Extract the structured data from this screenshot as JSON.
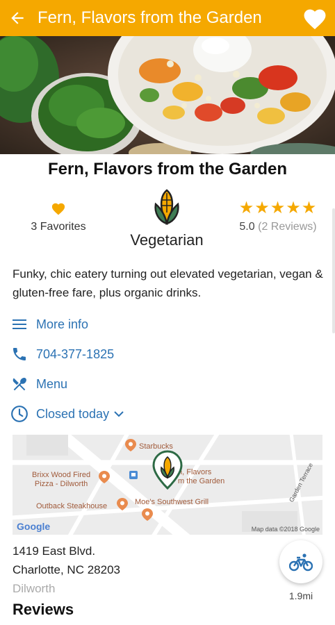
{
  "header": {
    "title": "Fern, Flavors from the Garden",
    "bg_color": "#f5a800",
    "back_icon": "arrow-left-icon",
    "favorite_icon": "heart-icon"
  },
  "restaurant": {
    "name": "Fern, Flavors from the Garden",
    "favorites": "3 Favorites",
    "category": "Vegetarian",
    "category_icon": "corn-icon",
    "stars": "★★★★★",
    "rating": "5.0",
    "reviews_count": "(2 Reviews)",
    "description": "Funky, chic eatery turning out elevated vegetarian, vegan & gluten-free fare, plus organic drinks."
  },
  "actions": {
    "more_info": "More info",
    "phone": "704-377-1825",
    "menu": "Menu",
    "hours": "Closed today"
  },
  "map": {
    "labels": {
      "starbucks": "Starbucks",
      "brixx_line1": "Brixx Wood Fired",
      "brixx_line2": "Pizza - Dilworth",
      "fern_line1": "n, Flavors",
      "fern_line2": "m the Garden",
      "outback": "Outback Steakhouse",
      "moes": "Moe's Southwest Grill",
      "street": "Garden Terrace",
      "google": "Google",
      "attribution": "Map data ©2018 Google"
    }
  },
  "address": {
    "line1": "1419 East Blvd.",
    "line2": "Charlotte, NC 28203",
    "neighborhood": "Dilworth"
  },
  "travel": {
    "icon": "bicycle-icon",
    "distance": "1.9mi"
  },
  "reviews_heading": "Reviews",
  "colors": {
    "accent": "#f5a800",
    "link": "#2b72b3",
    "veg_green": "#3f7d54"
  }
}
